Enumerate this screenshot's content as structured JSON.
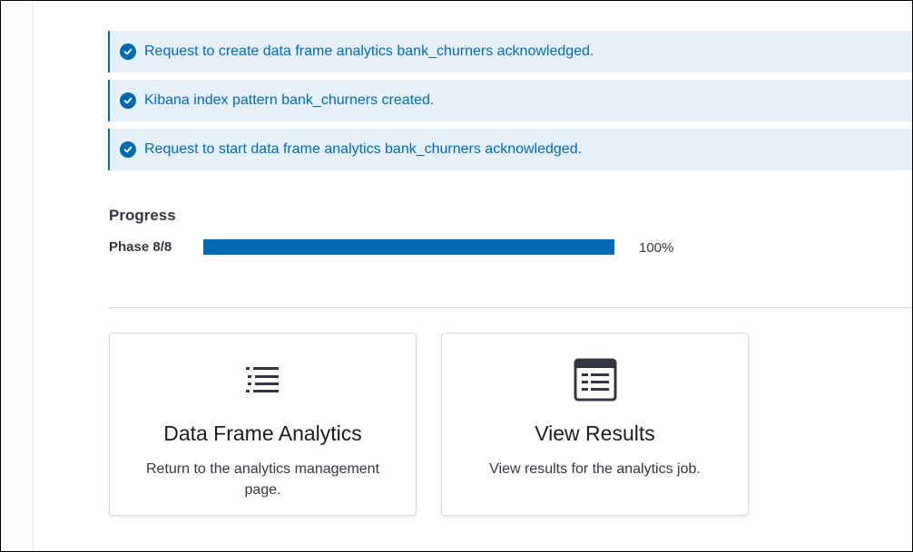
{
  "callouts": [
    {
      "text": "Request to create data frame analytics bank_churners acknowledged.",
      "icon": "check-circle-icon"
    },
    {
      "text": "Kibana index pattern bank_churners created.",
      "icon": "check-circle-icon"
    },
    {
      "text": "Request to start data frame analytics bank_churners acknowledged.",
      "icon": "check-circle-icon"
    }
  ],
  "progress": {
    "title": "Progress",
    "phase_label": "Phase 8/8",
    "value_percent": 100,
    "value_text": "100%"
  },
  "cards": [
    {
      "title": "Data Frame Analytics",
      "description": "Return to the analytics management page.",
      "icon": "list-icon"
    },
    {
      "title": "View Results",
      "description": "View results for the analytics job.",
      "icon": "table-icon"
    }
  ],
  "colors": {
    "accent": "#006bb4",
    "callout_background": "#e6f0f8",
    "text": "#343741"
  }
}
